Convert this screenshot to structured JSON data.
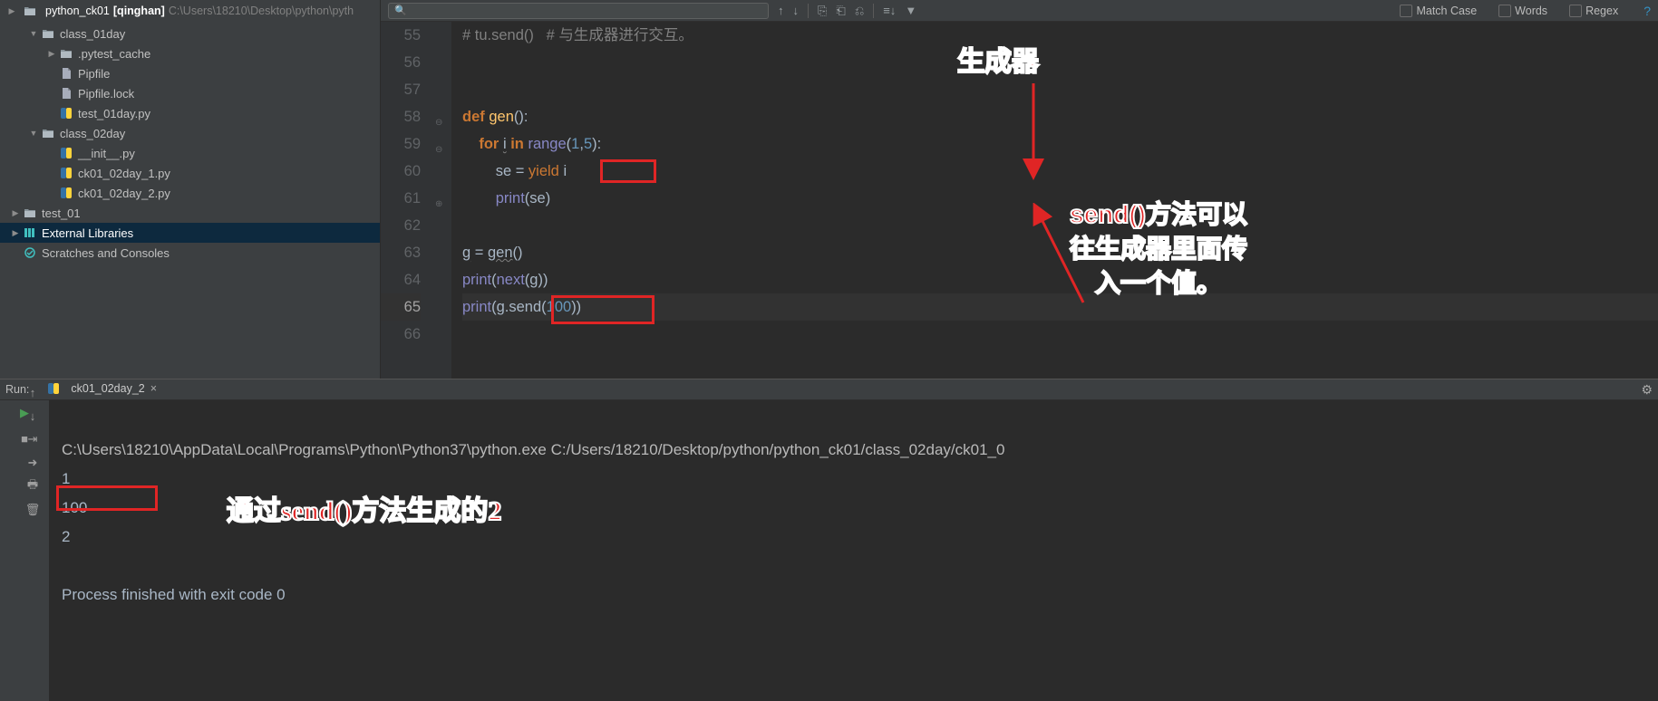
{
  "breadcrumb": {
    "root": "python_ck01",
    "branch": "[qinghan]",
    "path": "C:\\Users\\18210\\Desktop\\python\\pyth"
  },
  "tree": {
    "items": [
      {
        "depth": 1,
        "arrow": "▼",
        "icon": "folder",
        "label": "class_01day"
      },
      {
        "depth": 2,
        "arrow": "▶",
        "icon": "folder",
        "label": ".pytest_cache"
      },
      {
        "depth": 2,
        "arrow": "",
        "icon": "file",
        "label": "Pipfile"
      },
      {
        "depth": 2,
        "arrow": "",
        "icon": "file",
        "label": "Pipfile.lock"
      },
      {
        "depth": 2,
        "arrow": "",
        "icon": "py",
        "label": "test_01day.py"
      },
      {
        "depth": 1,
        "arrow": "▼",
        "icon": "folder",
        "label": "class_02day"
      },
      {
        "depth": 2,
        "arrow": "",
        "icon": "py",
        "label": "__init__.py"
      },
      {
        "depth": 2,
        "arrow": "",
        "icon": "py",
        "label": "ck01_02day_1.py"
      },
      {
        "depth": 2,
        "arrow": "",
        "icon": "py",
        "label": "ck01_02day_2.py"
      },
      {
        "depth": 0,
        "arrow": "▶",
        "icon": "folder",
        "label": "test_01"
      },
      {
        "depth": 0,
        "arrow": "▶",
        "icon": "lib",
        "label": "External Libraries",
        "sel": true
      },
      {
        "depth": 0,
        "arrow": "",
        "icon": "scratch",
        "label": "Scratches and Consoles"
      }
    ]
  },
  "find": {
    "placeholder": "",
    "matchCase": "Match Case",
    "words": "Words",
    "regex": "Regex"
  },
  "code": {
    "lines": [
      55,
      56,
      57,
      58,
      59,
      60,
      61,
      62,
      63,
      64,
      65,
      66
    ],
    "current": 65,
    "l55": "# tu.send()   # 与生成器进行交互。",
    "l58_def": "def ",
    "l58_fn": "gen",
    "l58_tail": "():",
    "l59_pad": "    ",
    "l59_for": "for ",
    "l59_i": "i",
    "l59_in": " in ",
    "l59_rng": "range",
    "l59_args": "(",
    "l59_n1": "1",
    "l59_c": ",",
    "l59_n2": "5",
    "l59_end": "):",
    "l60_pad": "        ",
    "l60_se": "se = ",
    "l60_yield": "yield",
    "l60_i": " i",
    "l61_pad": "        ",
    "l61_print": "print",
    "l61_arg": "(se)",
    "l63_pad": "",
    "l63_g": "g",
    "l63_eq": " = ",
    "l63_gen": "gen",
    "l63_call": "()",
    "l64_print": "print",
    "l64_open": "(",
    "l64_next": "next",
    "l64_arg": "(g))",
    "l65_print": "print",
    "l65_open": "(g.",
    "l65_send": "send",
    "l65_p": "(",
    "l65_num": "100",
    "l65_end": "))"
  },
  "annotations": {
    "gen_label": "生成器",
    "send_label": "send()方法可以\n往生成器里面传\n入一个值。",
    "console_label": "通过send()方法生成的2"
  },
  "run": {
    "label": "Run:",
    "tab": "ck01_02day_2",
    "command": "C:\\Users\\18210\\AppData\\Local\\Programs\\Python\\Python37\\python.exe C:/Users/18210/Desktop/python/python_ck01/class_02day/ck01_0",
    "out1": "1",
    "out2": "100",
    "out3": "2",
    "blank": "",
    "finished": "Process finished with exit code 0"
  }
}
